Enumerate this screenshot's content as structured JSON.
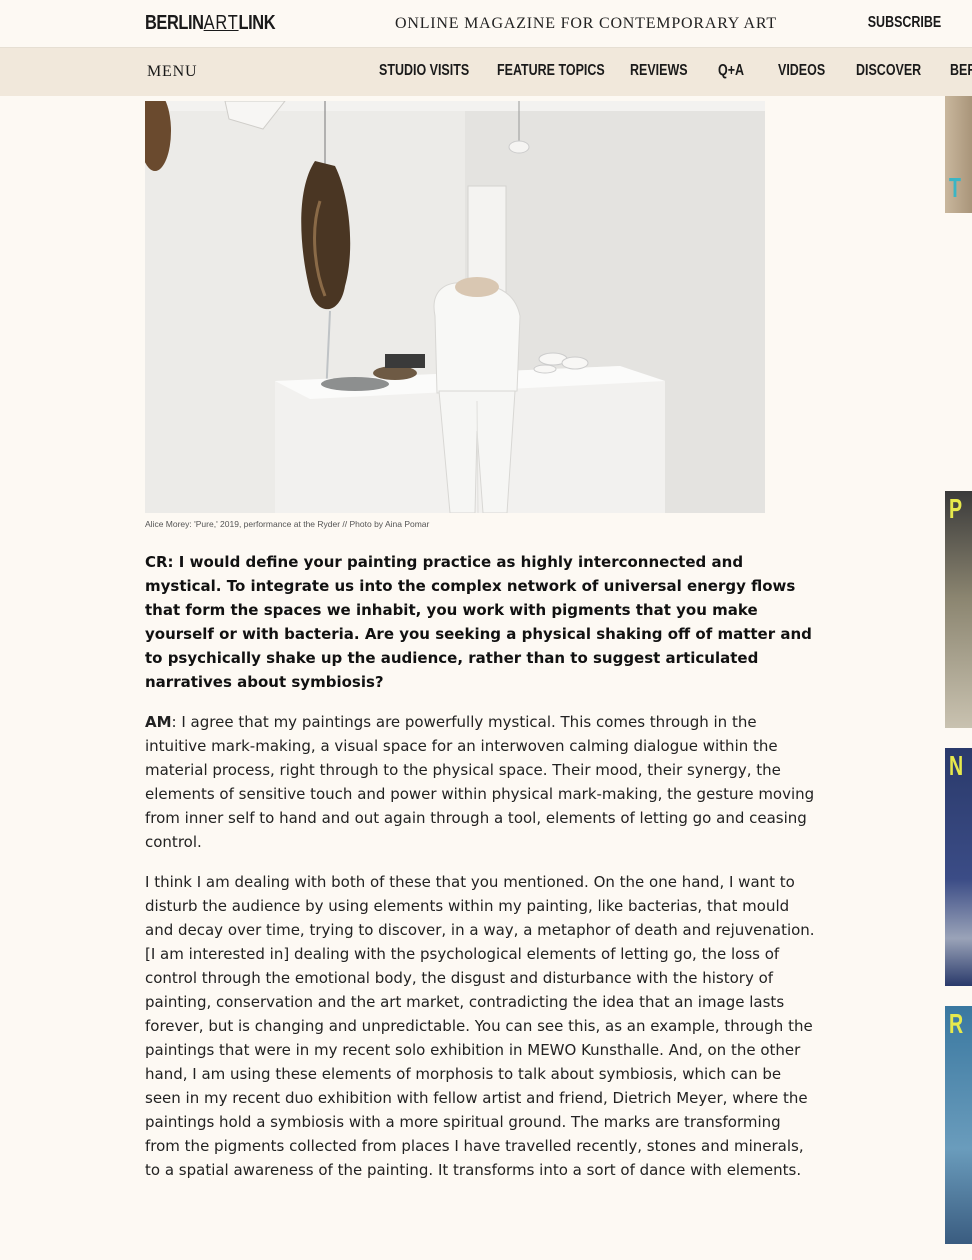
{
  "header": {
    "logo_part1": "BERLIN",
    "logo_part2": "ART",
    "logo_part3": "LINK",
    "tagline": "ONLINE MAGAZINE FOR CONTEMPORARY ART",
    "subscribe": "SUBSCRIBE"
  },
  "nav": {
    "menu": "MENU",
    "items": [
      "STUDIO VISITS",
      "FEATURE TOPICS",
      "REVIEWS",
      "Q+A",
      "VIDEOS",
      "DISCOVER",
      "BER"
    ]
  },
  "figure": {
    "caption": "Alice Morey: 'Pure,' 2019, performance at the Ryder // Photo by Aina Pomar"
  },
  "article": {
    "question": "CR: I would define your painting practice as highly interconnected and mystical. To integrate us into the complex network of universal energy flows that form the spaces we inhabit, you work with pigments that you make yourself or with bacteria. Are you seeking a physical shaking off of matter and to psychically shake up the audience, rather than to suggest articulated narratives about symbiosis?",
    "answer_speaker": "AM",
    "answer_p1": ": I agree that my paintings are powerfully mystical. This comes through in the intuitive mark-making, a visual space for an interwoven calming dialogue within the material process, right through to the physical space. Their mood, their synergy, the elements of sensitive touch and power within physical mark-making, the gesture moving from inner self to hand and out again through a tool, elements of letting go and ceasing control.",
    "answer_p2": "I think I am dealing with both of these that you mentioned. On the one hand, I want to disturb the audience by using elements within my painting, like bacterias, that mould and decay over time, trying to discover, in a way, a metaphor of death and rejuvenation. [I am interested in] dealing with the psychological elements of letting go, the loss of control through the emotional body, the disgust and disturbance with the history of painting, conservation and the art market, contradicting the idea that an image lasts forever, but is changing and unpredictable. You can see this, as an example, through the paintings that were in my recent solo exhibition in MEWO Kunsthalle. And, on the other hand, I am using these elements of morphosis to talk about symbiosis, which can be seen in my recent duo exhibition with fellow artist and friend, Dietrich Meyer, where the paintings hold a symbiosis with a more spiritual ground. The marks are transforming from the pigments collected from places I have travelled recently, stones and minerals, to a spatial awareness of the painting. It transforms into a sort of dance with elements."
  },
  "ads": [
    {
      "text": "T"
    },
    {
      "text": "P"
    },
    {
      "text": "N"
    },
    {
      "text": "R"
    }
  ],
  "colors": {
    "page_bg": "#fdf9f3",
    "nav_bg": "#f1e8db",
    "ad_teal": "#3bb5c4",
    "ad_yellow": "#e7e94c"
  }
}
